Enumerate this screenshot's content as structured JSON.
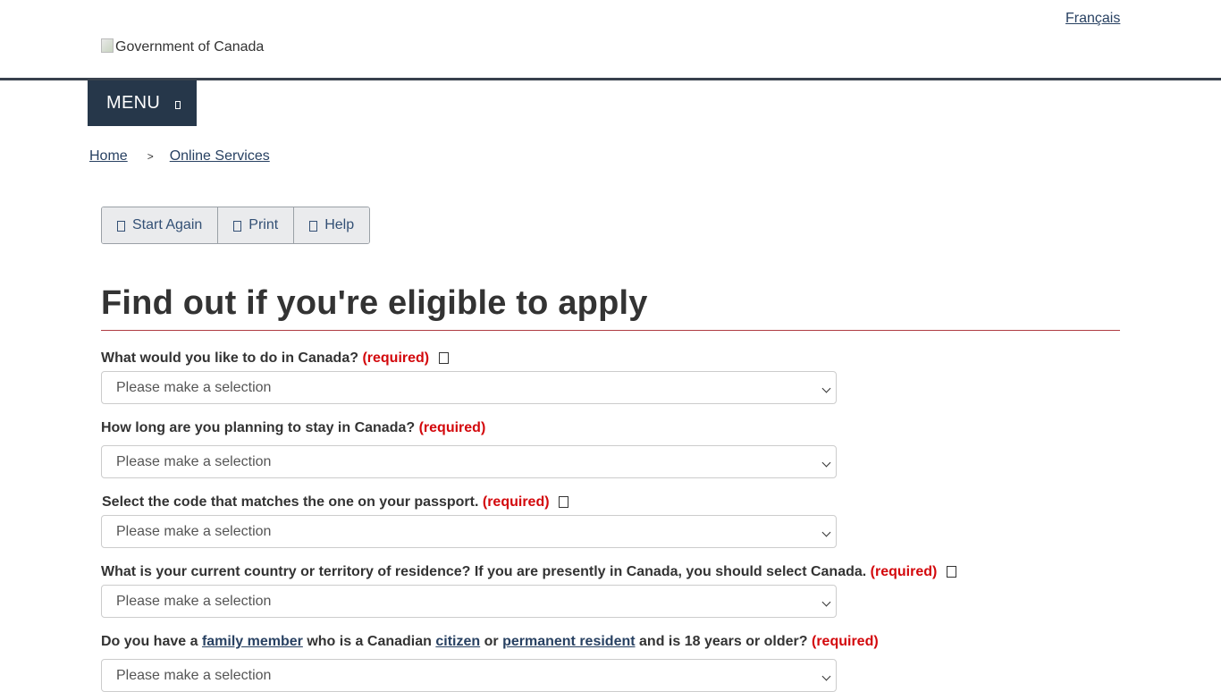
{
  "header": {
    "language_link": "Français",
    "logo_alt": "Government of Canada",
    "menu_label": "MENU"
  },
  "breadcrumb": {
    "items": [
      "Home",
      "Online Services"
    ],
    "separator": ">"
  },
  "toolbar": {
    "buttons": [
      "Start Again",
      "Print",
      "Help"
    ]
  },
  "page": {
    "title": "Find out if you're eligible to apply"
  },
  "form": {
    "required_text": "(required)",
    "select_placeholder": "Please make a selection",
    "questions": [
      {
        "label": "What would you like to do in Canada?"
      },
      {
        "label": "How long are you planning to stay in Canada?"
      },
      {
        "label": "Select the code that matches the one on your passport."
      },
      {
        "label": "What is your current country or territory of residence? If you are presently in Canada, you should select Canada."
      },
      {
        "parts": [
          "Do you have a",
          "family member",
          "who is a Canadian",
          "citizen",
          "or",
          "permanent resident",
          "and is 18 years or older?"
        ]
      }
    ]
  },
  "colors": {
    "brand_dark": "#26374a",
    "link": "#284162",
    "required": "#d3080c",
    "title_rule": "#af3c43"
  }
}
